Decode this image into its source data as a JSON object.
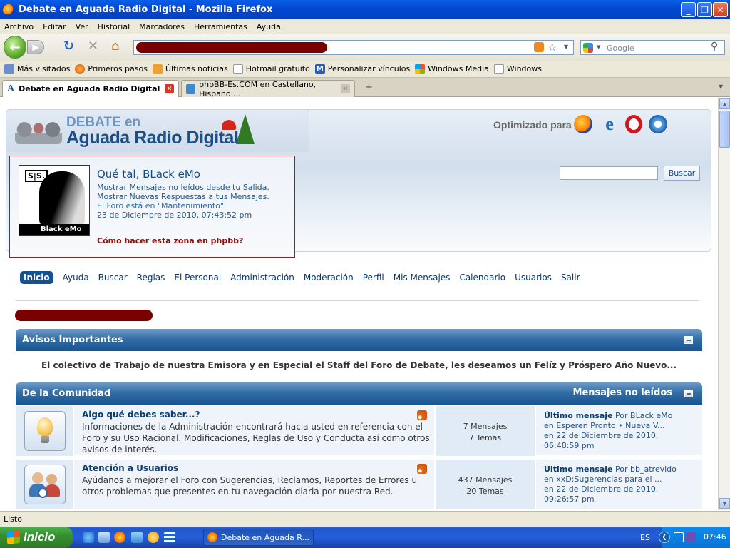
{
  "window": {
    "title": "Debate en Aguada Radio Digital - Mozilla Firefox"
  },
  "menu": [
    "Archivo",
    "Editar",
    "Ver",
    "Historial",
    "Marcadores",
    "Herramientas",
    "Ayuda"
  ],
  "search": {
    "placeholder": "Google"
  },
  "bookmarks": [
    "Más visitados",
    "Primeros pasos",
    "Últimas noticias",
    "Hotmail gratuito",
    "Personalizar vínculos",
    "Windows Media",
    "Windows"
  ],
  "tabs": [
    {
      "label": "Debate en Aguada Radio Digital"
    },
    {
      "label": "phpBB-Es.COM en Castellano, Hispano ..."
    }
  ],
  "site": {
    "logo_top": "DEBATE en",
    "logo_main": "Aguada Radio Digital",
    "optimized": "Optimizado para"
  },
  "user": {
    "greeting": "Qué tal, BLack eMo",
    "line1": "Mostrar Mensajes no leídos desde tu Salida.",
    "line2": "Mostrar Nuevas Respuestas a tus Mensajes.",
    "line3": "El Foro está en \"Mantenimiento\".",
    "line4": "23 de Diciembre de 2010, 07:43:52 pm",
    "how": "Cómo hacer esta zona en phpbb?",
    "avatar_text": "Black eMo",
    "avatar_badge": "S|S."
  },
  "forum_search": {
    "button": "Buscar"
  },
  "nav": [
    "Inicio",
    "Ayuda",
    "Buscar",
    "Reglas",
    "El Personal",
    "Administración",
    "Moderación",
    "Perfil",
    "Mis Mensajes",
    "Calendario",
    "Usuarios",
    "Salir"
  ],
  "notice": {
    "title": "Avisos Importantes",
    "text": "El colectivo de Trabajo de nuestra Emisora y en Especial el Staff del Foro de Debate, les deseamos un Felíz y Próspero Año Nuevo..."
  },
  "category": {
    "title": "De la Comunidad",
    "unread": "Mensajes no leídos"
  },
  "forums": [
    {
      "title": "Algo qué debes saber...?",
      "desc": "Informaciones de la Administración encontrará hacia usted en referencia con el Foro y su Uso Racional. Modificaciones, Reglas de Uso y Conducta así como otros avisos de interés.",
      "posts": "7 Mensajes",
      "topics": "7 Temas",
      "last_label": "Último mensaje",
      "last_by": " Por BLack eMo",
      "last_in": "en Esperen Pronto • Nueva V...",
      "last_date": "en 22 de Diciembre de 2010,",
      "last_time": "06:48:59 pm"
    },
    {
      "title": "Atención a Usuarios",
      "desc": "Ayúdanos a mejorar el Foro con Sugerencias, Reclamos, Reportes de Errores u otros problemas que presentes en tu navegación diaria por nuestra Red.",
      "posts": "437 Mensajes",
      "topics": "20 Temas",
      "last_label": "Último mensaje",
      "last_by": " Por bb_atrevido",
      "last_in": "en xxD:Sugerencias para el ...",
      "last_date": "en 22 de Diciembre de 2010,",
      "last_time": "09:26:57 pm"
    }
  ],
  "status": {
    "text": "Listo"
  },
  "taskbar": {
    "start": "Inicio",
    "item": "Debate en Aguada R...",
    "lang": "ES",
    "clock": "07:46"
  },
  "colors": {
    "accent": "#135192",
    "redaction": "#7a0000"
  }
}
